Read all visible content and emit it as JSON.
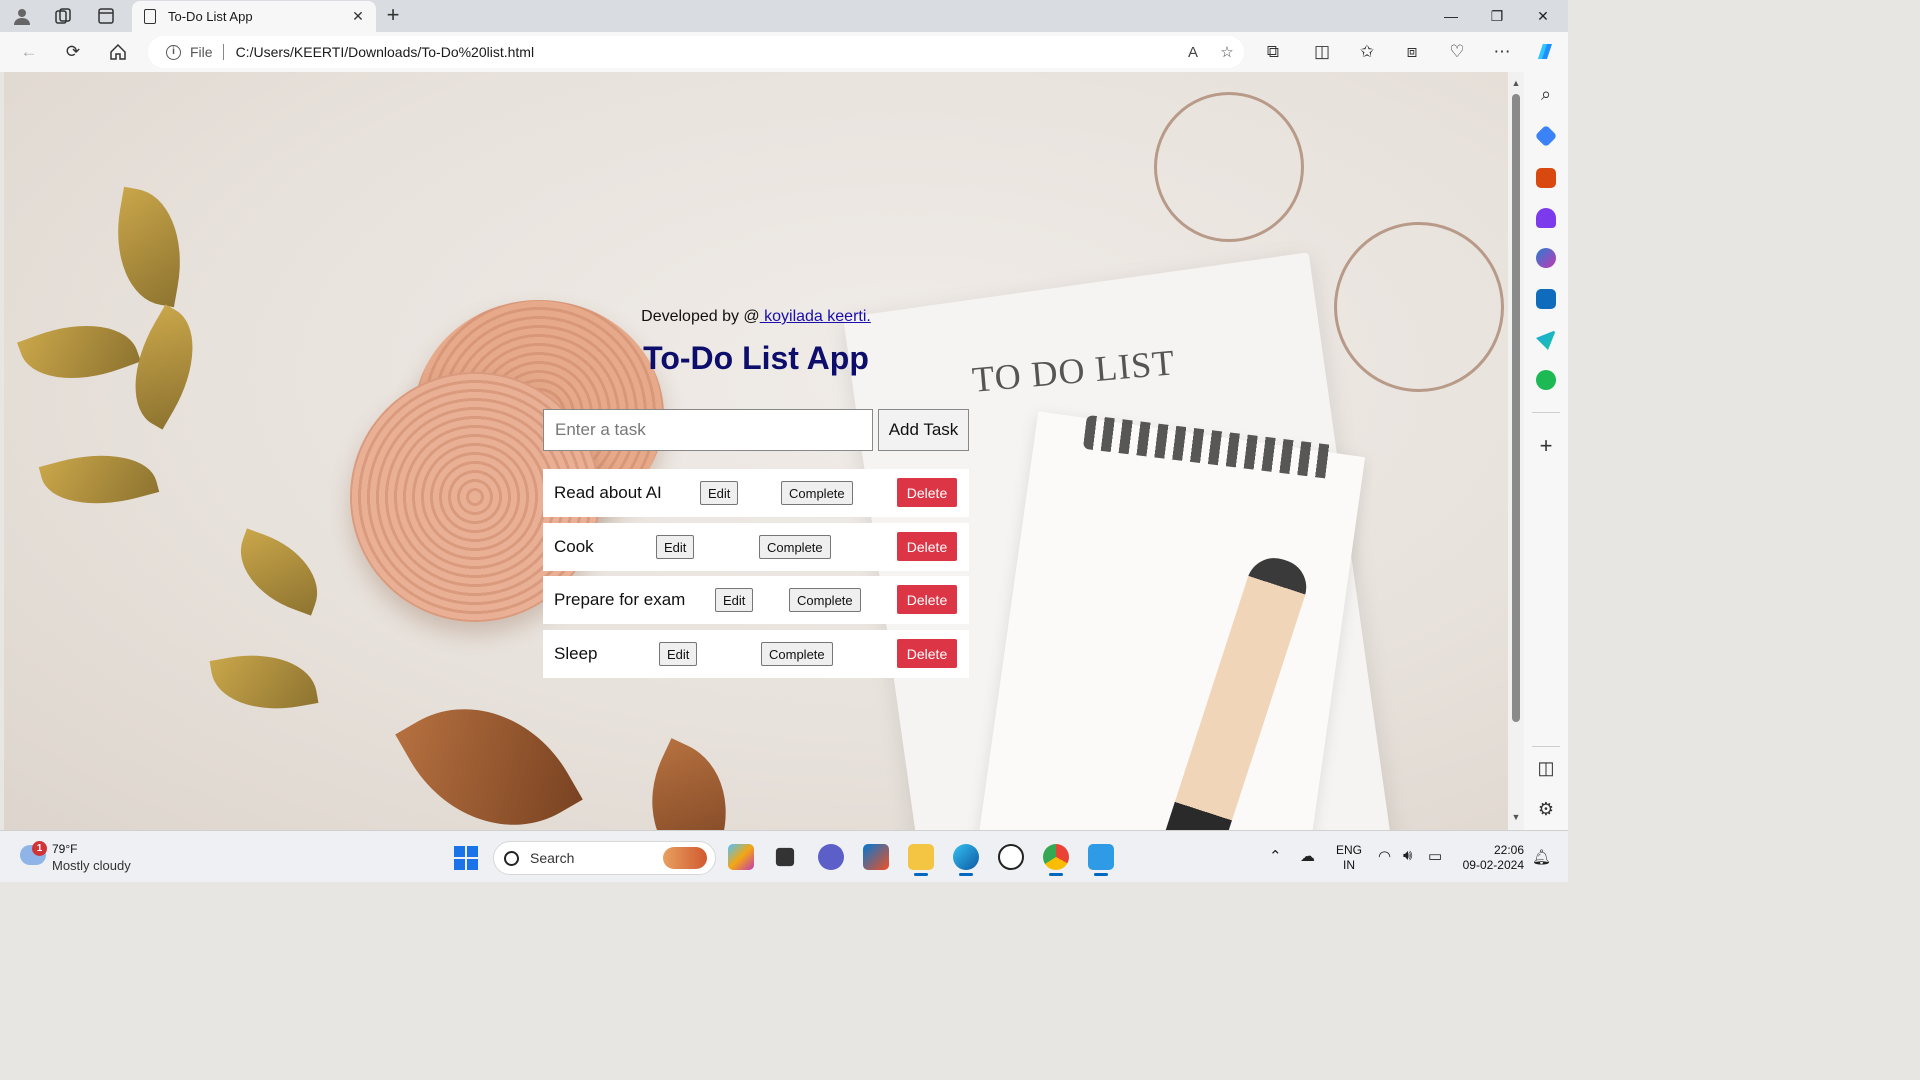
{
  "browser": {
    "tab": {
      "title": "To-Do List App"
    },
    "address": {
      "scheme": "File",
      "url": "C:/Users/KEERTI/Downloads/To-Do%20list.html"
    }
  },
  "page": {
    "credit_prefix": "Developed by @",
    "credit_link": " koyilada keerti.",
    "title": "To-Do List App",
    "input_placeholder": "Enter a task",
    "add_button": "Add Task",
    "tasks": [
      {
        "name": "Read about AI",
        "edit": "Edit",
        "complete": "Complete",
        "delete": "Delete"
      },
      {
        "name": "Cook",
        "edit": "Edit",
        "complete": "Complete",
        "delete": "Delete"
      },
      {
        "name": "Prepare for exam",
        "edit": "Edit",
        "complete": "Complete",
        "delete": "Delete"
      },
      {
        "name": "Sleep",
        "edit": "Edit",
        "complete": "Complete",
        "delete": "Delete"
      }
    ],
    "background_text": "TO DO LIST"
  },
  "taskbar": {
    "weather": {
      "badge": "1",
      "temp": "79°F",
      "desc": "Mostly cloudy"
    },
    "search_label": "Search",
    "lang_line1": "ENG",
    "lang_line2": "IN",
    "time": "22:06",
    "date": "09-02-2024"
  },
  "colors": {
    "title": "#0d0d6b",
    "delete": "#dc3545",
    "link": "#1a0dab"
  }
}
